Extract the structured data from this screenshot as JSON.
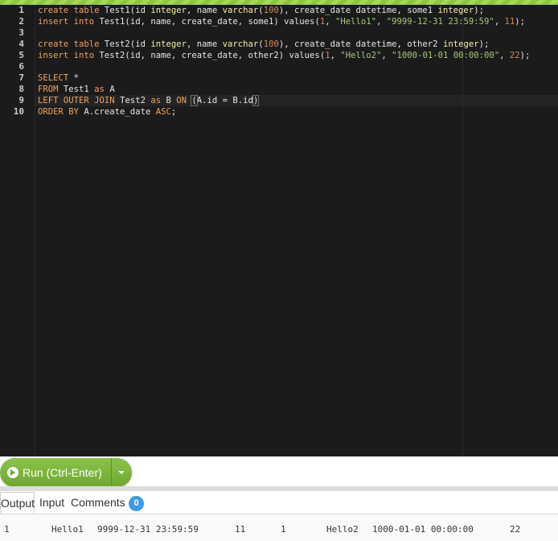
{
  "editor": {
    "line_numbers": [
      "1",
      "2",
      "3",
      "4",
      "5",
      "6",
      "7",
      "8",
      "9",
      "10"
    ],
    "lines": [
      [
        {
          "t": "create table ",
          "c": "kw"
        },
        {
          "t": "Test1(id ",
          "c": "plain"
        },
        {
          "t": "integer",
          "c": "type"
        },
        {
          "t": ", name ",
          "c": "plain"
        },
        {
          "t": "varchar",
          "c": "type"
        },
        {
          "t": "(",
          "c": "plain"
        },
        {
          "t": "100",
          "c": "num"
        },
        {
          "t": "), create_date datetime, some1 ",
          "c": "plain"
        },
        {
          "t": "integer",
          "c": "type"
        },
        {
          "t": ");",
          "c": "plain"
        }
      ],
      [
        {
          "t": "insert into ",
          "c": "kw"
        },
        {
          "t": "Test1(id, name, create_date, some1) ",
          "c": "plain"
        },
        {
          "t": "values",
          "c": "plain"
        },
        {
          "t": "(",
          "c": "plain"
        },
        {
          "t": "1",
          "c": "num"
        },
        {
          "t": ", ",
          "c": "plain"
        },
        {
          "t": "\"Hello1\"",
          "c": "str"
        },
        {
          "t": ", ",
          "c": "plain"
        },
        {
          "t": "\"9999-12-31 23:59:59\"",
          "c": "str"
        },
        {
          "t": ", ",
          "c": "plain"
        },
        {
          "t": "11",
          "c": "num"
        },
        {
          "t": ");",
          "c": "plain"
        }
      ],
      [],
      [
        {
          "t": "create table ",
          "c": "kw"
        },
        {
          "t": "Test2(id ",
          "c": "plain"
        },
        {
          "t": "integer",
          "c": "type"
        },
        {
          "t": ", name ",
          "c": "plain"
        },
        {
          "t": "varchar",
          "c": "type"
        },
        {
          "t": "(",
          "c": "plain"
        },
        {
          "t": "100",
          "c": "num"
        },
        {
          "t": "), create_date datetime, other2 ",
          "c": "plain"
        },
        {
          "t": "integer",
          "c": "type"
        },
        {
          "t": ");",
          "c": "plain"
        }
      ],
      [
        {
          "t": "insert into ",
          "c": "kw"
        },
        {
          "t": "Test2(id, name, create_date, other2) ",
          "c": "plain"
        },
        {
          "t": "values",
          "c": "plain"
        },
        {
          "t": "(",
          "c": "plain"
        },
        {
          "t": "1",
          "c": "num"
        },
        {
          "t": ", ",
          "c": "plain"
        },
        {
          "t": "\"Hello2\"",
          "c": "str"
        },
        {
          "t": ", ",
          "c": "plain"
        },
        {
          "t": "\"1000-01-01 00:00:00\"",
          "c": "str"
        },
        {
          "t": ", ",
          "c": "plain"
        },
        {
          "t": "22",
          "c": "num"
        },
        {
          "t": ");",
          "c": "plain"
        }
      ],
      [],
      [
        {
          "t": "SELECT ",
          "c": "kw"
        },
        {
          "t": "*",
          "c": "plain"
        }
      ],
      [
        {
          "t": "FROM ",
          "c": "kw"
        },
        {
          "t": "Test1 ",
          "c": "plain"
        },
        {
          "t": "as ",
          "c": "kw"
        },
        {
          "t": "A",
          "c": "plain"
        }
      ],
      [
        {
          "t": "LEFT OUTER JOIN ",
          "c": "kw"
        },
        {
          "t": "Test2 ",
          "c": "plain"
        },
        {
          "t": "as ",
          "c": "kw"
        },
        {
          "t": "B ",
          "c": "plain"
        },
        {
          "t": "ON ",
          "c": "kw"
        },
        {
          "t": "(",
          "c": "bracket"
        },
        {
          "t": "A.id = B.id",
          "c": "plain"
        },
        {
          "t": ")",
          "c": "bracket"
        }
      ],
      [
        {
          "t": "ORDER BY ",
          "c": "kw"
        },
        {
          "t": "A.create_date ",
          "c": "plain"
        },
        {
          "t": "ASC",
          "c": "kw"
        },
        {
          "t": ";",
          "c": "plain"
        }
      ]
    ]
  },
  "toolbar": {
    "run_label": "Run (Ctrl-Enter)"
  },
  "tabs": {
    "output": "Output",
    "input": "Input",
    "comments": "Comments",
    "comments_count": "0"
  },
  "output_row": [
    "1",
    "Hello1",
    "9999-12-31 23:59:59",
    "11",
    "1",
    "Hello2",
    "1000-01-01 00:00:00",
    "22"
  ],
  "colors": {
    "accent": "#8bc34a",
    "badge": "#3d9be9",
    "editor_bg": "#1b1b1b"
  },
  "icons": {
    "run": "play-circle-icon",
    "caret": "caret-down-icon"
  }
}
